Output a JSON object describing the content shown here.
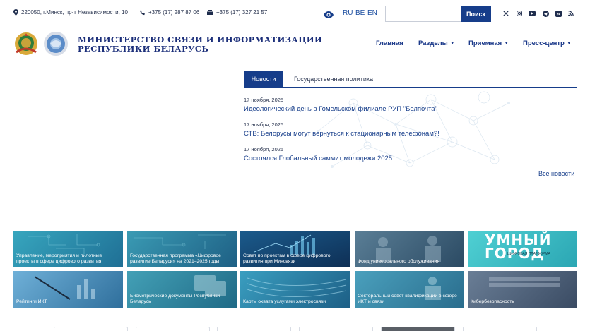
{
  "topbar": {
    "address": "220050, г.Минск, пр-т Независимости, 10",
    "phone": "+375 (17) 287 87 06",
    "fax": "+375 (17) 327 21 57",
    "languages": [
      "RU",
      "BE",
      "EN"
    ],
    "search_placeholder": "",
    "search_button": "Поиск",
    "social_icons": [
      "x-icon",
      "instagram-icon",
      "youtube-icon",
      "telegram-icon",
      "vk-icon",
      "rss-icon"
    ]
  },
  "header": {
    "ministry_line1": "МИНИСТЕРСТВО СВЯЗИ И ИНФОРМАТИЗАЦИИ",
    "ministry_line2": "РЕСПУБЛИКИ БЕЛАРУСЬ",
    "nav": [
      {
        "label": "Главная",
        "dropdown": false
      },
      {
        "label": "Разделы",
        "dropdown": true
      },
      {
        "label": "Приемная",
        "dropdown": true
      },
      {
        "label": "Пресс-центр",
        "dropdown": true
      }
    ]
  },
  "news": {
    "tabs": [
      "Новости",
      "Государственная политика"
    ],
    "items": [
      {
        "date": "17 ноября, 2025",
        "title": "Идеологический день в Гомельском филиале РУП \"Белпочта\""
      },
      {
        "date": "17 ноября, 2025",
        "title": "СТВ: Белорусы могут вернуться к стационарным телефонам?!"
      },
      {
        "date": "17 ноября, 2025",
        "title": "Состоялся Глобальный саммит молодежи 2025"
      }
    ],
    "all_news": "Все новости"
  },
  "tiles": [
    {
      "caption": "Управление, мероприятия и пилотные проекты в сфере цифрового развития",
      "color": "#2a8fa8"
    },
    {
      "caption": "Государственная программа «Цифровое развитие Беларуси» на 2021–2025 годы",
      "color": "#2a7f9e"
    },
    {
      "caption": "Совет по проектам в сфере цифрового развития при Минсвязи",
      "color": "#1f5f86"
    },
    {
      "caption": "Фонд универсального обслуживания",
      "color": "#3e6f86"
    },
    {
      "caption": "",
      "big_text": "УМНЫЙ ГОРОД",
      "small_text": "ЦИФРОВАЯ ПЛАТФОРМА",
      "color": "#3fbfc6"
    },
    {
      "caption": "Рейтинги ИКТ",
      "color": "#3d86b5"
    },
    {
      "caption": "Биометрические документы Республики Беларусь",
      "color": "#2b7f9a"
    },
    {
      "caption": "Карты охвата услугами электросвязи",
      "color": "#2a86a6"
    },
    {
      "caption": "Секторальный совет квалификаций в сфере ИКТ и связи",
      "color": "#3589a4"
    },
    {
      "caption": "Кибербезопасность",
      "color": "#4a5e78"
    }
  ]
}
